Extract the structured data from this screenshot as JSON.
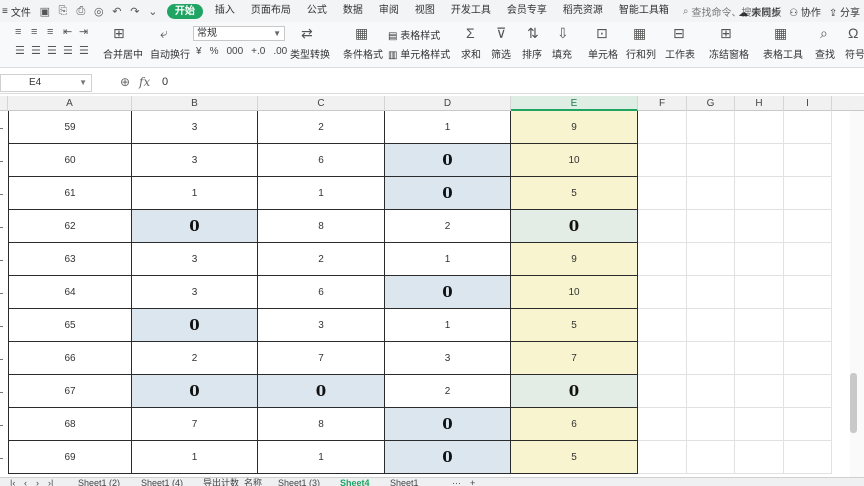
{
  "menu": {
    "file_label": "文件",
    "tabs": [
      "开始",
      "插入",
      "页面布局",
      "公式",
      "数据",
      "审阅",
      "视图",
      "开发工具",
      "会员专享",
      "稻壳资源",
      "智能工具箱"
    ],
    "active_tab": "开始",
    "search_label": "查找命令、搜索模板",
    "sync_label": "未同步",
    "collab_label": "协作",
    "share_label": "分享"
  },
  "ribbon": {
    "merge_label": "合并居中",
    "wrap_label": "自动换行",
    "number_format": "常规",
    "currency_symbols": [
      "¥",
      "%",
      "000",
      "+.0",
      ".00"
    ],
    "type_convert_label": "类型转换",
    "cond_format_label": "条件格式",
    "table_style_label": "表格样式",
    "cell_style_label": "单元格样式",
    "sum_label": "求和",
    "filter_label": "筛选",
    "sort_label": "排序",
    "fill_label": "填充",
    "cell_label": "单元格",
    "rowcol_label": "行和列",
    "sheet_label": "工作表",
    "freeze_label": "冻结窗格",
    "tabletool_label": "表格工具",
    "find_label": "查找",
    "symbol_label": "符号"
  },
  "formula_bar": {
    "cell_ref": "E4",
    "value": "0"
  },
  "columns": [
    "A",
    "B",
    "C",
    "D",
    "E",
    "F",
    "G",
    "H",
    "I"
  ],
  "selected_column": "E",
  "rows": [
    {
      "a": "59",
      "b": "3",
      "c": "2",
      "d": "1",
      "e": "9"
    },
    {
      "a": "60",
      "b": "3",
      "c": "6",
      "d": "0",
      "e": "10"
    },
    {
      "a": "61",
      "b": "1",
      "c": "1",
      "d": "0",
      "e": "5"
    },
    {
      "a": "62",
      "b": "0",
      "c": "8",
      "d": "2",
      "e": "0"
    },
    {
      "a": "63",
      "b": "3",
      "c": "2",
      "d": "1",
      "e": "9"
    },
    {
      "a": "64",
      "b": "3",
      "c": "6",
      "d": "0",
      "e": "10"
    },
    {
      "a": "65",
      "b": "0",
      "c": "3",
      "d": "1",
      "e": "5"
    },
    {
      "a": "66",
      "b": "2",
      "c": "7",
      "d": "3",
      "e": "7"
    },
    {
      "a": "67",
      "b": "0",
      "c": "0",
      "d": "2",
      "e": "0"
    },
    {
      "a": "68",
      "b": "7",
      "c": "8",
      "d": "0",
      "e": "6"
    },
    {
      "a": "69",
      "b": "1",
      "c": "1",
      "d": "0",
      "e": "5"
    }
  ],
  "sheet_tabs": [
    "Sheet1 (2)",
    "Sheet1 (4)",
    "导出计数_名称",
    "Sheet1 (3)",
    "Sheet4",
    "Sheet1"
  ],
  "active_sheet": "Sheet4",
  "colors": {
    "accent": "#1fa463",
    "zero_highlight": "#dce6ee",
    "e_column_fill": "#f7f4cf",
    "e_zero_fill": "#e4ece6"
  }
}
